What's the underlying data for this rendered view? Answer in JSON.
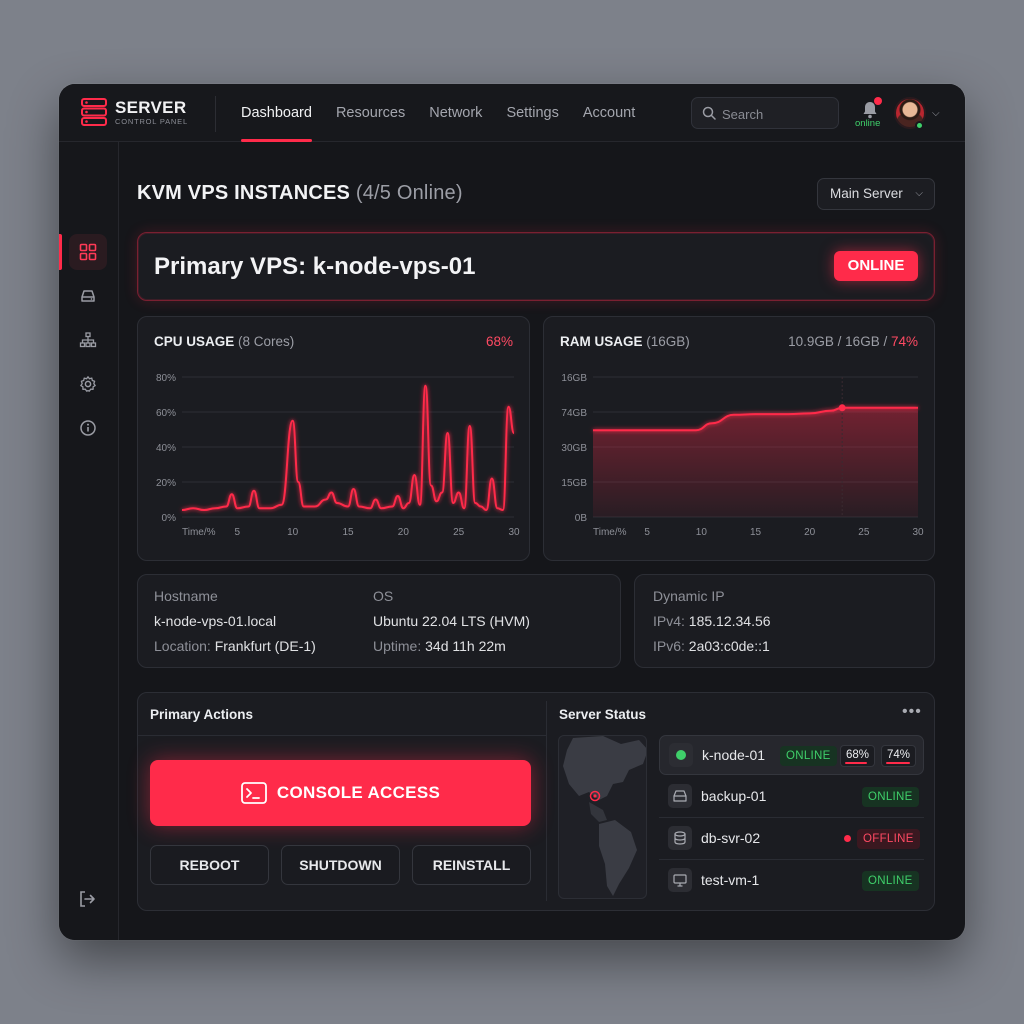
{
  "brand": {
    "title": "SERVER",
    "subtitle": "CONTROL PANEL"
  },
  "nav": [
    "Dashboard",
    "Resources",
    "Network",
    "Settings",
    "Account"
  ],
  "search": {
    "placeholder": "Search"
  },
  "user": {
    "status": "online"
  },
  "sidebar": [
    "dashboard-icon",
    "drive-icon",
    "network-icon",
    "gear-icon",
    "info-icon"
  ],
  "page": {
    "title": "KVM VPS INSTANCES",
    "subtitle": "(4/5 Online)",
    "server_select": "Main Server"
  },
  "primary": {
    "title": "Primary VPS: k-node-vps-01",
    "status": "ONLINE"
  },
  "cpu": {
    "title": "CPU USAGE",
    "subtitle": "(8 Cores)",
    "value": "68%"
  },
  "ram": {
    "title": "RAM USAGE",
    "subtitle": "(16GB)",
    "used": "10.9GB / 16GB /",
    "percent": "74%"
  },
  "chart_data": [
    {
      "type": "line",
      "title": "CPU USAGE (8 Cores)",
      "xlabel": "Time/%",
      "x_ticks": [
        "5",
        "10",
        "15",
        "20",
        "25",
        "30"
      ],
      "y_ticks": [
        "0%",
        "20%",
        "40%",
        "60%",
        "80%"
      ],
      "ylim": [
        0,
        80
      ],
      "xlim": [
        0,
        30
      ],
      "series": [
        {
          "x": [
            0,
            1,
            2,
            3,
            4,
            4.5,
            5,
            6,
            6.5,
            7,
            8,
            9,
            10,
            10.5,
            11,
            12,
            13,
            13.5,
            14,
            15,
            15.5,
            16,
            17,
            17.5,
            18,
            19,
            19.5,
            20,
            20.5,
            21,
            21.5,
            22,
            22.5,
            23,
            23.5,
            24,
            24.5,
            25,
            25.5,
            26,
            26.5,
            27,
            27.5,
            28,
            28.5,
            29,
            29.5,
            30
          ],
          "y": [
            4,
            5,
            4,
            5,
            6,
            13,
            5,
            6,
            15,
            5,
            5,
            7,
            55,
            20,
            6,
            6,
            10,
            14,
            8,
            6,
            16,
            6,
            5,
            10,
            5,
            6,
            12,
            5,
            8,
            24,
            7,
            75,
            18,
            9,
            14,
            48,
            8,
            14,
            5,
            52,
            8,
            6,
            4,
            22,
            5,
            4,
            63,
            48
          ]
        }
      ]
    },
    {
      "type": "area",
      "title": "RAM USAGE (16GB)",
      "xlabel": "Time/%",
      "x_ticks": [
        "5",
        "10",
        "15",
        "20",
        "25",
        "30"
      ],
      "y_ticks": [
        "0B",
        "15GB",
        "30GB",
        "74GB",
        "16GB"
      ],
      "xlim": [
        0,
        30
      ],
      "series": [
        {
          "name": "RAM",
          "x": [
            0,
            5,
            9.5,
            11,
            13,
            15,
            18,
            20,
            22,
            23,
            24,
            26,
            28,
            30
          ],
          "y": [
            0.62,
            0.62,
            0.62,
            0.67,
            0.73,
            0.735,
            0.735,
            0.74,
            0.76,
            0.78,
            0.78,
            0.78,
            0.78,
            0.78
          ]
        }
      ]
    }
  ],
  "info": {
    "hostname_label": "Hostname",
    "hostname": "k-node-vps-01.local",
    "location_label": "Location:",
    "location": "Frankfurt (DE-1)",
    "os_label": "OS",
    "os": "Ubuntu 22.04 LTS (HVM)",
    "uptime_label": "Uptime:",
    "uptime": "34d 11h 22m",
    "ip_label": "Dynamic IP",
    "ipv4_label": "IPv4:",
    "ipv4": "185.12.34.56",
    "ipv6_label": "IPv6:",
    "ipv6": "2a03:c0de::1"
  },
  "actions": {
    "title": "Primary Actions",
    "console": "CONSOLE ACCESS",
    "reboot": "REBOOT",
    "shutdown": "SHUTDOWN",
    "reinstall": "REINSTALL"
  },
  "status": {
    "title": "Server Status",
    "servers": [
      {
        "name": "k-node-01",
        "status": "ONLINE",
        "cpu": "68%",
        "ram": "74%",
        "cpu_fill": 0.68,
        "ram_fill": 0.74,
        "icon": "status-dot-icon"
      },
      {
        "name": "backup-01",
        "status": "ONLINE",
        "icon": "drive-icon"
      },
      {
        "name": "db-svr-02",
        "status": "OFFLINE",
        "icon": "database-icon"
      },
      {
        "name": "test-vm-1",
        "status": "ONLINE",
        "icon": "monitor-icon"
      }
    ]
  },
  "colors": {
    "accent": "#ff2b4a",
    "online": "#3fcf6a",
    "background": "#15161a",
    "card": "#1b1c21"
  }
}
